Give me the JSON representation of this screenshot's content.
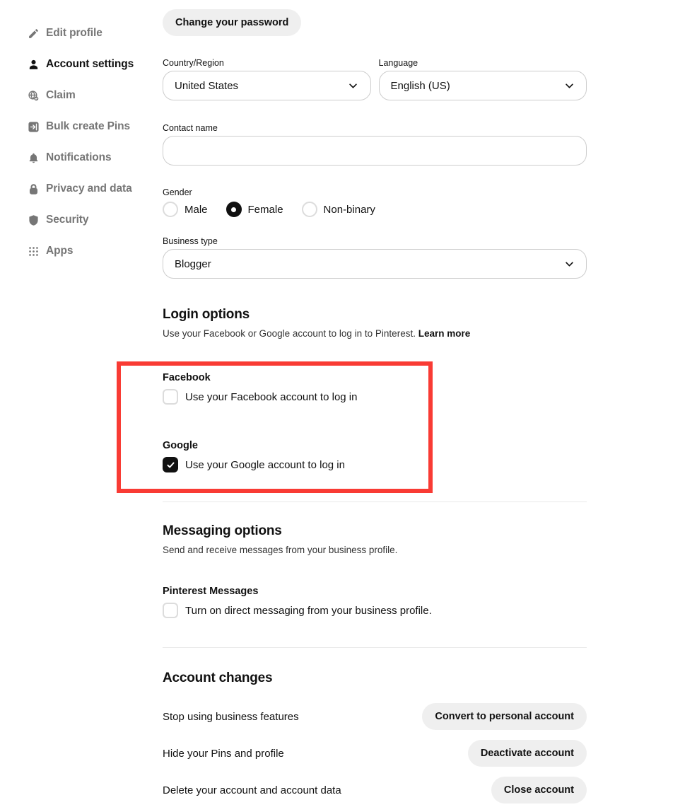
{
  "sidebar": {
    "items": [
      {
        "label": "Edit profile",
        "icon": "pencil-icon",
        "active": false
      },
      {
        "label": "Account settings",
        "icon": "person-icon",
        "active": true
      },
      {
        "label": "Claim",
        "icon": "globe-check-icon",
        "active": false
      },
      {
        "label": "Bulk create Pins",
        "icon": "import-arrow-icon",
        "active": false
      },
      {
        "label": "Notifications",
        "icon": "bell-icon",
        "active": false
      },
      {
        "label": "Privacy and data",
        "icon": "lock-icon",
        "active": false
      },
      {
        "label": "Security",
        "icon": "shield-icon",
        "active": false
      },
      {
        "label": "Apps",
        "icon": "grid-dots-icon",
        "active": false
      }
    ]
  },
  "main": {
    "change_password_label": "Change your password",
    "country": {
      "label": "Country/Region",
      "value": "United States"
    },
    "language": {
      "label": "Language",
      "value": "English (US)"
    },
    "contact_name": {
      "label": "Contact name",
      "value": "",
      "placeholder": ""
    },
    "gender": {
      "label": "Gender",
      "options": [
        {
          "label": "Male",
          "selected": false
        },
        {
          "label": "Female",
          "selected": true
        },
        {
          "label": "Non-binary",
          "selected": false
        }
      ]
    },
    "business_type": {
      "label": "Business type",
      "value": "Blogger"
    },
    "login_options": {
      "title": "Login options",
      "subtitle_text": "Use your Facebook or Google account to log in to Pinterest.",
      "subtitle_link": "Learn more",
      "facebook": {
        "title": "Facebook",
        "checkbox_label": "Use your Facebook account to log in",
        "checked": false
      },
      "google": {
        "title": "Google",
        "checkbox_label": "Use your Google account to log in",
        "checked": true
      }
    },
    "messaging_options": {
      "title": "Messaging options",
      "subtitle": "Send and receive messages from your business profile.",
      "pinterest_messages": {
        "title": "Pinterest Messages",
        "checkbox_label": "Turn on direct messaging from your business profile.",
        "checked": false
      }
    },
    "account_changes": {
      "title": "Account changes",
      "rows": [
        {
          "desc": "Stop using business features",
          "button": "Convert to personal account"
        },
        {
          "desc": "Hide your Pins and profile",
          "button": "Deactivate account"
        },
        {
          "desc": "Delete your account and account data",
          "button": "Close account"
        }
      ]
    }
  },
  "annotation": {
    "highlight_color": "#f93b34"
  }
}
